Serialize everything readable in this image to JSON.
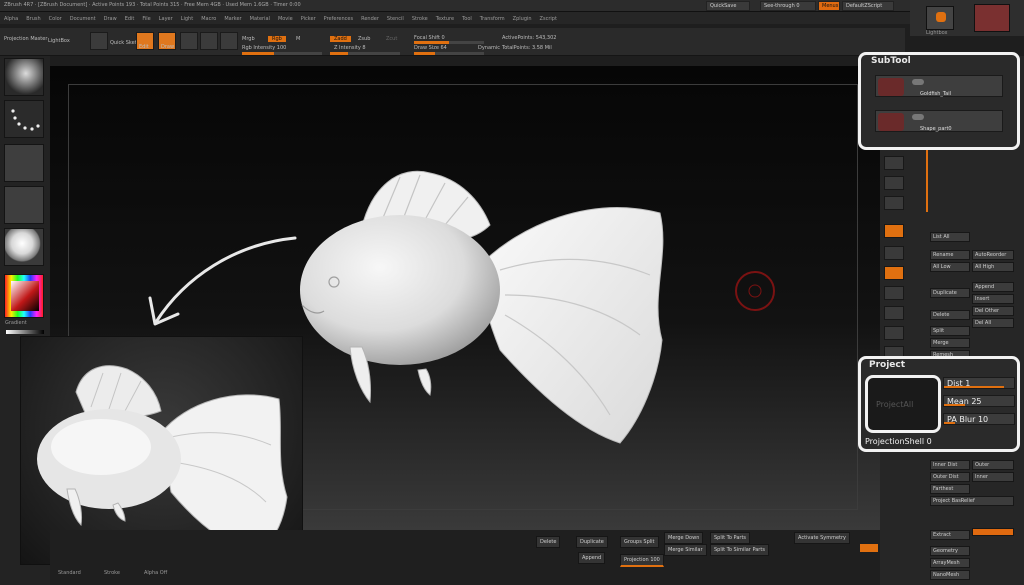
{
  "window": {
    "title": "ZBrush 4R7 · [ZBrush Document] · Active Points 193 · Total Points 315 · Free Mem 4GB · Used Mem 1.6GB · Timer 0:00"
  },
  "menu": [
    "Alpha",
    "Brush",
    "Color",
    "Document",
    "Draw",
    "Edit",
    "File",
    "Layer",
    "Light",
    "Macro",
    "Marker",
    "Material",
    "Movie",
    "Picker",
    "Preferences",
    "Render",
    "Stencil",
    "Stroke",
    "Texture",
    "Tool",
    "Transform",
    "Zplugin",
    "Zscript"
  ],
  "top_right": {
    "quicksave": "QuickSave",
    "seethrough": "See-through 0",
    "menus": "Menus",
    "default_zscript": "DefaultZScript"
  },
  "toolbar": {
    "projection": "Projection Master",
    "lightbox": "LightBox",
    "quick_sketch": "Quick Sketch",
    "edit": "Edit",
    "draw": "Draw",
    "move": "Move",
    "scale": "Scale",
    "rotate": "Rotate",
    "mrgb": "Mrgb",
    "rgb": "Rgb",
    "m": "M",
    "rgb_intensity": "Rgb Intensity 100",
    "zadd": "Zadd",
    "zsub": "Zsub",
    "zcut": "Zcut",
    "z_intensity": "Z Intensity 8",
    "focal_shift": "Focal Shift 0",
    "draw_size": "Draw Size 64",
    "dynamic": "Dynamic",
    "active_points": "ActivePoints: 543,302",
    "total_points": "TotalPoints: 3.58 Mil",
    "colors": {
      "accent": "#e0781e"
    }
  },
  "left_shelf": {
    "items": [
      "brush-thumbnail",
      "stroke-thumbnail",
      "alpha-thumbnail",
      "texture-thumbnail",
      "material-thumbnail",
      "color-picker"
    ],
    "gradient_label": "Gradient"
  },
  "canvas": {
    "gizmo": "gizmo-circle"
  },
  "right_side_icons": [
    "scroll",
    "zoom",
    "actual",
    "aahalf",
    "persp",
    "floor",
    "local",
    "lsym",
    "xyz",
    "frame",
    "move",
    "scale",
    "rotate",
    "polyf",
    "transp",
    "solo",
    "xpose"
  ],
  "right_panel": {
    "top_tabs": [
      "Lightbox",
      "Tool"
    ],
    "subtool": {
      "title": "SubTool",
      "items": [
        {
          "name": "Goldfish_Tail"
        },
        {
          "name": "Shape_part0"
        }
      ]
    },
    "rows": [
      {
        "label": "List All"
      },
      {
        "label": "Rename"
      },
      {
        "label": "AutoReorder"
      },
      {
        "label": "All Low"
      },
      {
        "label": "All High"
      },
      {
        "label": "Duplicate"
      },
      {
        "label": "Append"
      },
      {
        "label": "Insert"
      },
      {
        "label": "Delete"
      },
      {
        "label": "Del Other"
      },
      {
        "label": "Del All"
      },
      {
        "label": "Split"
      },
      {
        "label": "Merge"
      },
      {
        "label": "Remesh"
      }
    ],
    "project": {
      "title": "Project",
      "thumb_label": "ProjectAll",
      "dist": "Dist 1",
      "mean": "Mean 25",
      "pa_blur": "PA Blur 10",
      "projection_shell": "ProjectionShell 0"
    },
    "lower_rows": [
      {
        "label": "Inner Dist"
      },
      {
        "label": "Outer Dist"
      },
      {
        "label": "Farthest"
      },
      {
        "label": "Outer"
      },
      {
        "label": "Inner"
      },
      {
        "label": "Project BasRelief"
      },
      {
        "label": "Extract"
      },
      {
        "label": "Geometry"
      },
      {
        "label": "ArrayMesh"
      },
      {
        "label": "NanoMesh"
      }
    ]
  },
  "bottom_bar": {
    "buttons": [
      "Delete",
      "Duplicate",
      "Append",
      "Groups Split",
      "Merge Down",
      "Split To Parts",
      "Merge Similar",
      "Split To Similar Parts",
      "Activate Symmetry",
      "Projection 100"
    ]
  },
  "inset": {
    "labels": [
      "Standard",
      "Stroke",
      "Alpha Off"
    ]
  }
}
